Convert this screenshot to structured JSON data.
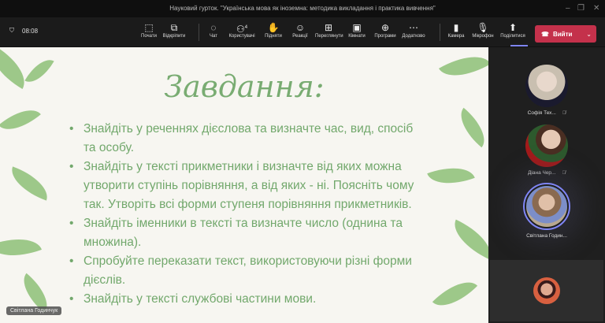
{
  "window": {
    "title": "Науковий гурток. \"Українська мова як іноземна: методика викладання і практика вивчення\""
  },
  "toolbar": {
    "timer": "08:08",
    "buttons": [
      {
        "label": "Почати",
        "icon": "record-icon"
      },
      {
        "label": "Відкріпити",
        "icon": "popout-icon"
      },
      {
        "label": "Чат",
        "icon": "chat-icon"
      },
      {
        "label": "Користувачі",
        "icon": "people-icon",
        "badge": "4"
      },
      {
        "label": "Підняти",
        "icon": "hand-icon"
      },
      {
        "label": "Реакції",
        "icon": "smile-icon"
      },
      {
        "label": "Переглянути",
        "icon": "grid-icon"
      },
      {
        "label": "Кімнати",
        "icon": "rooms-icon"
      },
      {
        "label": "Програми",
        "icon": "apps-icon"
      },
      {
        "label": "Додатково",
        "icon": "more-icon"
      },
      {
        "label": "Камера",
        "icon": "camera-off-icon"
      },
      {
        "label": "Мікрофон",
        "icon": "mic-icon"
      },
      {
        "label": "Поділитися",
        "icon": "share-icon"
      }
    ],
    "leave_label": "Вийти",
    "accent": "#c4314b"
  },
  "slide": {
    "title": "Завдання:",
    "tasks": [
      "Знайдіть у реченнях дієслова та визначте час, вид, спосіб та особу.",
      "Знайдіть у тексті прикметники і визначте від яких можна утворити ступінь порівняння, а від яких -  ні. Поясніть чому так. Утворіть всі форми ступеня порівняння прикметників.",
      "Знайдіть іменники в тексті та визначте число (однина та множина).",
      "Спробуйте переказати текст, використовуючи різні форми дієслів.",
      "Знайдіть у тексті службові частини мови."
    ],
    "presenter": "Світлана Годинчук"
  },
  "participants": [
    {
      "name": "Софія Тех...",
      "muted": true
    },
    {
      "name": "Діана Чер...",
      "muted": true
    },
    {
      "name": "Світлана Годин...",
      "muted": false,
      "speaking": true
    }
  ]
}
